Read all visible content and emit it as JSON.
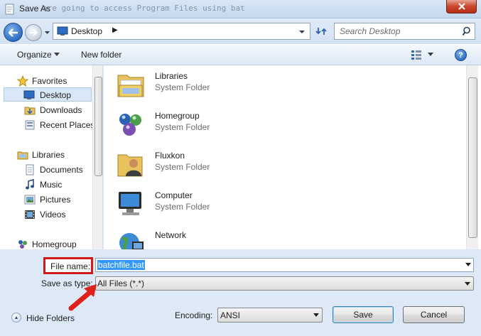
{
  "window": {
    "title": "Save As",
    "background_text": "are going to access Program Files using bat"
  },
  "nav": {
    "location": "Desktop",
    "search_placeholder": "Search Desktop"
  },
  "toolbar": {
    "organize_label": "Organize",
    "new_folder_label": "New folder"
  },
  "sidebar": {
    "items": [
      {
        "label": "Favorites",
        "icon": "star-icon"
      },
      {
        "label": "Desktop",
        "icon": "desktop-icon",
        "selected": true
      },
      {
        "label": "Downloads",
        "icon": "downloads-icon"
      },
      {
        "label": "Recent Places",
        "icon": "recent-places-icon"
      },
      {
        "label": "Libraries",
        "icon": "libraries-icon"
      },
      {
        "label": "Documents",
        "icon": "documents-icon"
      },
      {
        "label": "Music",
        "icon": "music-icon"
      },
      {
        "label": "Pictures",
        "icon": "pictures-icon"
      },
      {
        "label": "Videos",
        "icon": "videos-icon"
      },
      {
        "label": "Homegroup",
        "icon": "homegroup-icon"
      }
    ]
  },
  "main": {
    "items": [
      {
        "name": "Libraries",
        "type": "System Folder",
        "icon": "libraries-icon"
      },
      {
        "name": "Homegroup",
        "type": "System Folder",
        "icon": "homegroup-icon"
      },
      {
        "name": "Fluxkon",
        "type": "System Folder",
        "icon": "user-folder-icon"
      },
      {
        "name": "Computer",
        "type": "System Folder",
        "icon": "computer-icon"
      },
      {
        "name": "Network",
        "type": "",
        "icon": "network-icon"
      }
    ]
  },
  "form": {
    "filename_label": "File name:",
    "filename_value": "batchfile.bat",
    "savetype_label": "Save as type:",
    "savetype_value": "All Files  (*.*)",
    "encoding_label": "Encoding:",
    "encoding_value": "ANSI"
  },
  "bottom": {
    "hide_folders_label": "Hide Folders",
    "save_label": "Save",
    "cancel_label": "Cancel"
  },
  "colors": {
    "highlight_box": "#d21a1a",
    "selection": "#3399ff",
    "arrow": "#e0201b"
  }
}
